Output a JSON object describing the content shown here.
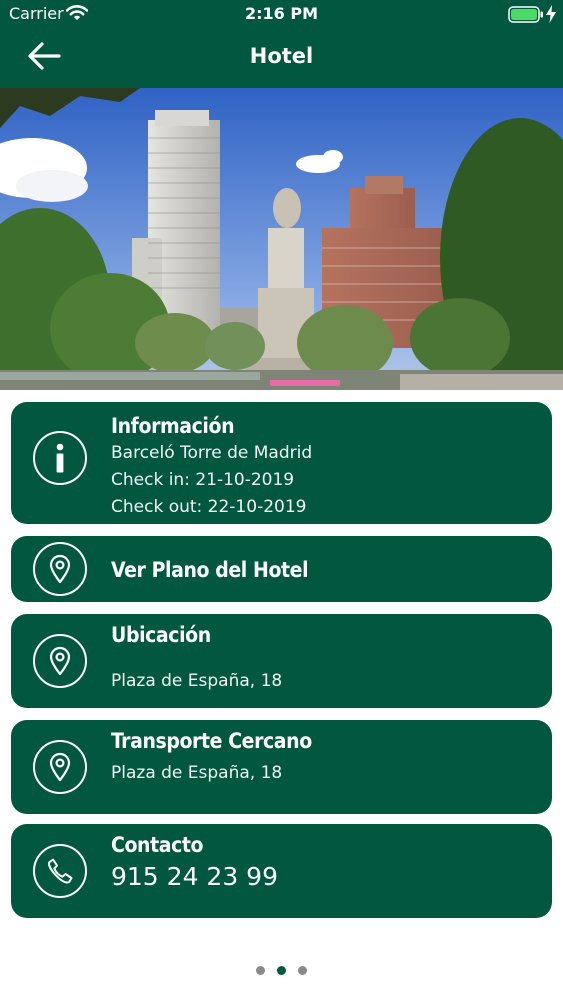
{
  "status_bar": {
    "carrier": "Carrier",
    "time": "2:16 PM"
  },
  "nav": {
    "title": "Hotel",
    "back_icon": "arrow-left-icon"
  },
  "hero": {
    "icon": "hotel-photo"
  },
  "cards": {
    "info": {
      "title": "Información",
      "lines": [
        "Barceló Torre de Madrid",
        "Check in: 21-10-2019",
        "Check out: 22-10-2019"
      ],
      "icon": "info-icon"
    },
    "map": {
      "title": "Ver Plano del Hotel",
      "icon": "location-pin-icon"
    },
    "location": {
      "title": "Ubicación",
      "address": "Plaza de España, 18",
      "icon": "location-pin-icon"
    },
    "transport": {
      "title": "Transporte Cercano",
      "address": "Plaza de España, 18",
      "icon": "location-pin-icon"
    },
    "contact": {
      "title": "Contacto",
      "phone": "915 24 23 99",
      "icon": "phone-icon"
    }
  },
  "pager": {
    "count": 3,
    "active_index": 1
  },
  "colors": {
    "brand": "#02583f",
    "background": "#ffffff",
    "inactive_dot": "#8a8a8a"
  }
}
